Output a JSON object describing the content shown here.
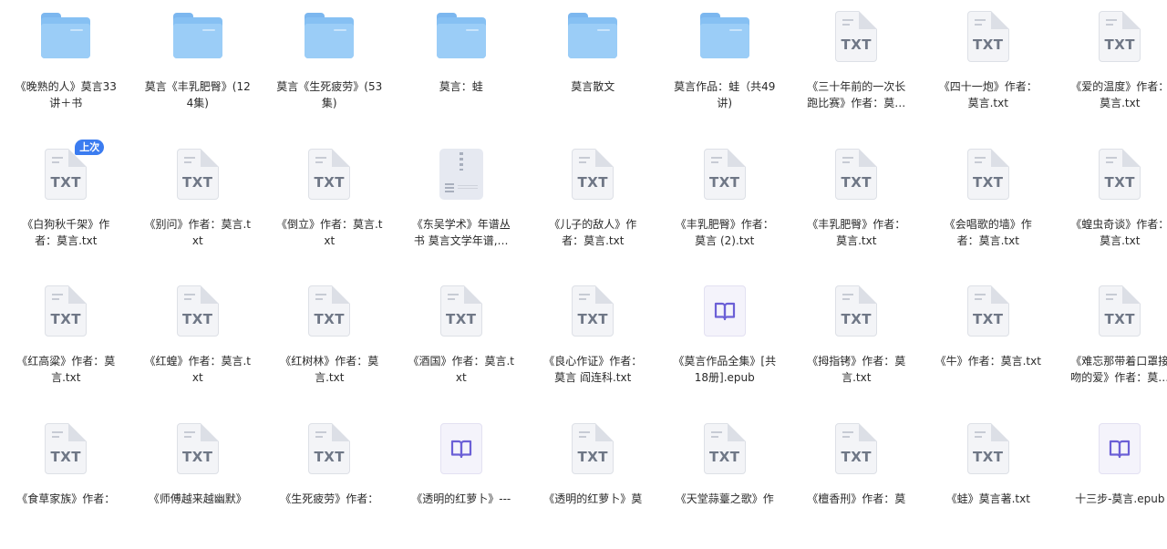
{
  "items": [
    {
      "type": "folder",
      "name": "《晚熟的人》莫言33讲＋书"
    },
    {
      "type": "folder",
      "name": "莫言《丰乳肥臀》(124集)"
    },
    {
      "type": "folder",
      "name": "莫言《生死疲劳》(53集)"
    },
    {
      "type": "folder",
      "name": "莫言：蛙"
    },
    {
      "type": "folder",
      "name": "莫言散文"
    },
    {
      "type": "folder",
      "name": "莫言作品：蛙（共49讲)"
    },
    {
      "type": "txt",
      "name": "《三十年前的一次长跑比赛》作者：莫…"
    },
    {
      "type": "txt",
      "name": "《四十一炮》作者：莫言.txt"
    },
    {
      "type": "txt",
      "name": "《爱的温度》作者：莫言.txt"
    },
    {
      "type": "txt",
      "name": "《白狗秋千架》作者：莫言.txt",
      "badge": "上次"
    },
    {
      "type": "txt",
      "name": "《别问》作者：莫言.txt"
    },
    {
      "type": "txt",
      "name": "《倒立》作者：莫言.txt"
    },
    {
      "type": "zip",
      "name": "《东吴学术》年谱丛书 莫言文学年谱,…"
    },
    {
      "type": "txt",
      "name": "《儿子的敌人》作者：莫言.txt"
    },
    {
      "type": "txt",
      "name": "《丰乳肥臀》作者：莫言 (2).txt"
    },
    {
      "type": "txt",
      "name": "《丰乳肥臀》作者：莫言.txt"
    },
    {
      "type": "txt",
      "name": "《会唱歌的墙》作者：莫言.txt"
    },
    {
      "type": "txt",
      "name": "《蝗虫奇谈》作者：莫言.txt"
    },
    {
      "type": "txt",
      "name": "《红高粱》作者：莫言.txt"
    },
    {
      "type": "txt",
      "name": "《红蝗》作者：莫言.txt"
    },
    {
      "type": "txt",
      "name": "《红树林》作者：莫言.txt"
    },
    {
      "type": "txt",
      "name": "《酒国》作者：莫言.txt"
    },
    {
      "type": "txt",
      "name": "《良心作证》作者：莫言 阎连科.txt"
    },
    {
      "type": "epub",
      "name": "《莫言作品全集》[共18册].epub"
    },
    {
      "type": "txt",
      "name": "《拇指铐》作者：莫言.txt"
    },
    {
      "type": "txt",
      "name": "《牛》作者：莫言.txt"
    },
    {
      "type": "txt",
      "name": "《难忘那带着口罩接吻的爱》作者：莫…"
    },
    {
      "type": "txt",
      "name": "《食草家族》作者："
    },
    {
      "type": "txt",
      "name": "《师傅越来越幽默》"
    },
    {
      "type": "txt",
      "name": "《生死疲劳》作者："
    },
    {
      "type": "epub",
      "name": "《透明的红萝卜》---"
    },
    {
      "type": "txt",
      "name": "《透明的红萝卜》莫"
    },
    {
      "type": "txt",
      "name": "《天堂蒜薹之歌》作"
    },
    {
      "type": "txt",
      "name": "《檀香刑》作者：莫"
    },
    {
      "type": "txt",
      "name": "《蛙》莫言著.txt"
    },
    {
      "type": "epub",
      "name": "十三步-莫言.epub"
    }
  ],
  "icons": {
    "txt_label": "TXT"
  }
}
